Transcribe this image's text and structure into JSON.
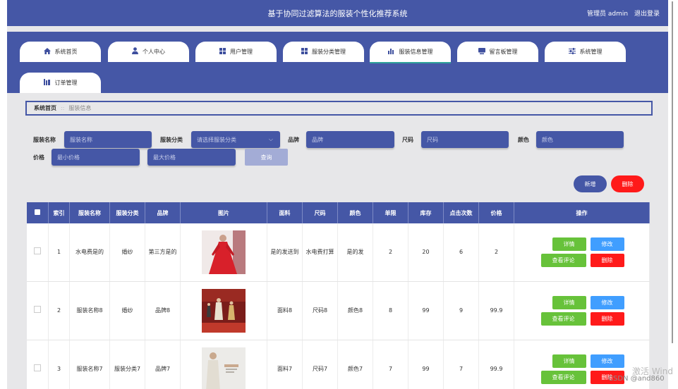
{
  "header": {
    "title": "基于协同过滤算法的服装个性化推荐系统",
    "user_label": "管理员 admin",
    "logout": "退出登录"
  },
  "tabs": [
    {
      "label": "系统首页",
      "icon": "home-icon"
    },
    {
      "label": "个人中心",
      "icon": "user-icon"
    },
    {
      "label": "用户管理",
      "icon": "grid-icon"
    },
    {
      "label": "服装分类管理",
      "icon": "grid-icon"
    },
    {
      "label": "服装信息管理",
      "icon": "bar-chart-icon",
      "active": true
    },
    {
      "label": "留言板管理",
      "icon": "message-icon"
    },
    {
      "label": "系统管理",
      "icon": "sliders-icon"
    },
    {
      "label": "订单管理",
      "icon": "order-icon"
    }
  ],
  "breadcrumb": {
    "home": "系统首页",
    "separator": "::",
    "current": "服装信息"
  },
  "search": {
    "name_label": "服装名称",
    "name_placeholder": "服装名称",
    "category_label": "服装分类",
    "category_placeholder": "请选择服装分类",
    "brand_label": "品牌",
    "brand_placeholder": "品牌",
    "size_label": "尺码",
    "size_placeholder": "尺码",
    "color_label": "颜色",
    "color_placeholder": "颜色",
    "price_label": "价格",
    "min_price_placeholder": "最小价格",
    "max_price_placeholder": "最大价格",
    "query": "查询"
  },
  "actions": {
    "add": "新增",
    "delete": "删除"
  },
  "table": {
    "columns": [
      "索引",
      "服装名称",
      "服装分类",
      "品牌",
      "图片",
      "面料",
      "尺码",
      "颜色",
      "单限",
      "库存",
      "点击次数",
      "价格",
      "操作"
    ],
    "row_buttons": {
      "detail": "详情",
      "edit": "修改",
      "comments": "查看评论",
      "delete": "删除"
    },
    "rows": [
      {
        "index": "1",
        "name": "水电费是的",
        "category": "婚纱",
        "brand": "第三方是的",
        "fabric": "是的发送到",
        "size": "水电费打算",
        "color": "是的发",
        "limit": "2",
        "stock": "20",
        "clicks": "6",
        "price": "2"
      },
      {
        "index": "2",
        "name": "服装名称8",
        "category": "婚纱",
        "brand": "品牌8",
        "fabric": "面料8",
        "size": "尺码8",
        "color": "颜色8",
        "limit": "8",
        "stock": "99",
        "clicks": "9",
        "price": "99.9"
      },
      {
        "index": "3",
        "name": "服装名称7",
        "category": "服装分类7",
        "brand": "品牌7",
        "fabric": "面料7",
        "size": "尺码7",
        "color": "颜色7",
        "limit": "7",
        "stock": "99",
        "clicks": "7",
        "price": "99.9"
      }
    ]
  },
  "watermark": {
    "activate": "激活 Wind",
    "csdn": "CSDN @and860"
  },
  "colors": {
    "primary": "#4557a6",
    "green": "#67c23a",
    "blue": "#409eff",
    "red": "#ff1a1a"
  }
}
